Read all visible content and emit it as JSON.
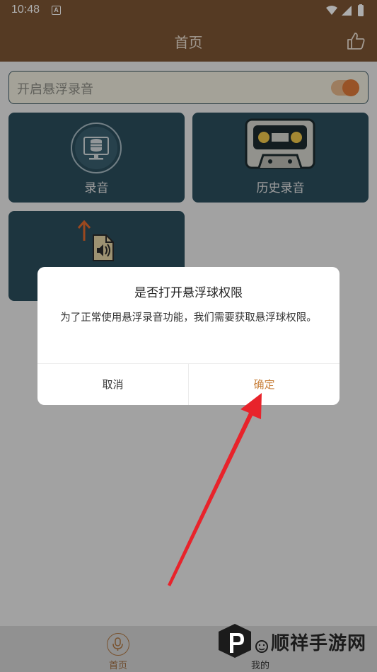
{
  "status_bar": {
    "time": "10:48",
    "notif": "A"
  },
  "header": {
    "title": "首页"
  },
  "float_toggle": {
    "label": "开启悬浮录音",
    "enabled": true
  },
  "cards": [
    {
      "label": "录音",
      "icon": "database-monitor-icon"
    },
    {
      "label": "历史录音",
      "icon": "cassette-icon"
    },
    {
      "label": "",
      "icon": "upload-audio-file-icon"
    }
  ],
  "dialog": {
    "title": "是否打开悬浮球权限",
    "message": "为了正常使用悬浮录音功能，我们需要获取悬浮球权限。",
    "cancel_label": "取消",
    "confirm_label": "确定"
  },
  "bottom_nav": {
    "home_label": "首页",
    "mine_label": "我的"
  },
  "watermark": {
    "text": "顺祥手游网"
  },
  "colors": {
    "header": "#7e5634",
    "card": "#2b4e5e",
    "accent": "#c8813d",
    "arrow": "#e8232b"
  }
}
